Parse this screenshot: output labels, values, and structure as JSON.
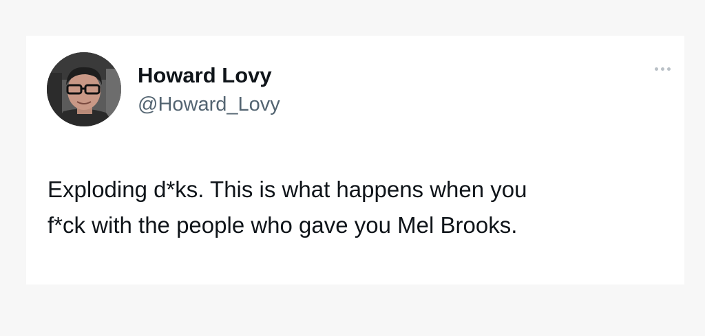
{
  "tweet": {
    "author": {
      "name": "Howard Lovy",
      "handle": "@Howard_Lovy",
      "avatar_icon": "profile-photo"
    },
    "more_icon": "more-options-icon",
    "text_lines": [
      "Exploding d*ks. This is what happens when you",
      "f*ck with the people who gave you Mel Brooks."
    ]
  },
  "colors": {
    "background": "#f7f7f7",
    "card": "#ffffff",
    "text_primary": "#0f1419",
    "text_secondary": "#536471",
    "more_dots": "#b9c0c6"
  }
}
